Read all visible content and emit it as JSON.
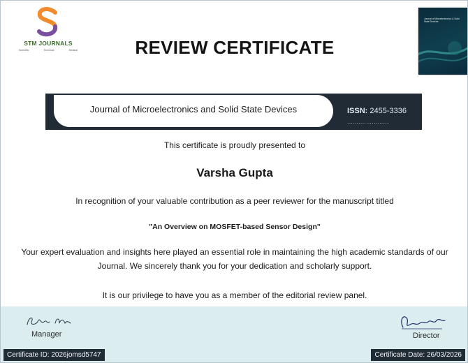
{
  "logo": {
    "name": "STM JOURNALS",
    "tagline": [
      "Scientific",
      "Technical",
      "Medical"
    ]
  },
  "title": "REVIEW CERTIFICATE",
  "cover": {
    "text": "Journal of Microelectronics & Solid State Devices"
  },
  "journal": {
    "name": "Journal of Microelectronics and Solid State Devices",
    "issn_label": "ISSN:",
    "issn_value": "2455-3336",
    "issn_dots": "......................"
  },
  "body": {
    "presented": "This certificate is proudly presented to",
    "recipient": "Varsha Gupta",
    "recognition": "In recognition of your valuable contribution as a peer reviewer for the manuscript titled",
    "manuscript": "\"An Overview on MOSFET-based Sensor Design\"",
    "paragraph": "Your expert evaluation and insights here played an essential role in maintaining the high academic standards of our Journal. We sincerely thank you for your dedication and scholarly support.",
    "privilege": "It is our privilege to have you as a member of the editorial review panel."
  },
  "footer": {
    "manager_signature": "Rahul Kumar",
    "manager_label": "Manager",
    "director_label": "Director",
    "certificate_id": "Certificate ID: 2026jomsd5747",
    "certificate_date": "Certificate Date: 26/03/2026"
  },
  "colors": {
    "dark_band": "#202b36",
    "footer_bg": "#dcedf0",
    "logo_orange": "#f28a2e",
    "logo_purple": "#7b4fa0",
    "logo_text": "#3a6b2a"
  }
}
